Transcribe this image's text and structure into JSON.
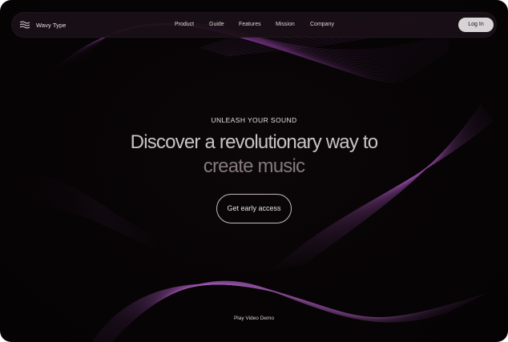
{
  "brand": {
    "name": "Wavy Type",
    "icon": "waves-icon"
  },
  "nav": {
    "links": [
      "Product",
      "Guide",
      "Features",
      "Mission",
      "Company"
    ],
    "login_label": "Log In"
  },
  "hero": {
    "eyebrow": "UNLEASH YOUR SOUND",
    "headline_line1": "Discover a revolutionary way to",
    "headline_line2": "create music",
    "cta_label": "Get early access"
  },
  "footer": {
    "video_link": "Play Video Demo"
  },
  "colors": {
    "background": "#060405",
    "accent_wave": "#b85ad0",
    "navbar": "#1a0f17",
    "login_button": "#d8d4d6"
  }
}
